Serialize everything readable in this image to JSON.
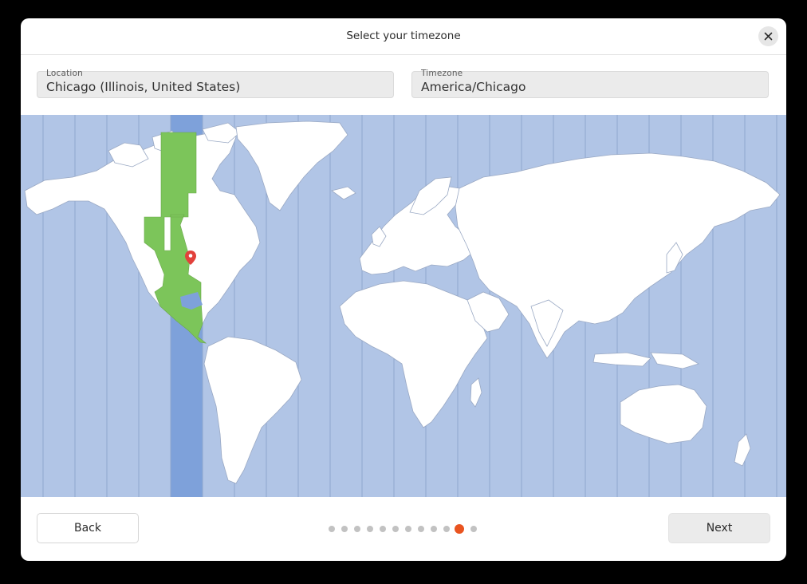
{
  "window": {
    "title": "Select your timezone"
  },
  "location": {
    "label": "Location",
    "value": "Chicago (Illinois, United States)"
  },
  "timezone": {
    "label": "Timezone",
    "value": "America/Chicago"
  },
  "map": {
    "selected_timezone": "America/Chicago",
    "marker": "map-pin-icon",
    "highlight_color": "#7cc55a",
    "band_color": "#7ea1da"
  },
  "navigation": {
    "back_label": "Back",
    "next_label": "Next",
    "step_count": 12,
    "current_step": 11,
    "active_color": "#e95420"
  }
}
